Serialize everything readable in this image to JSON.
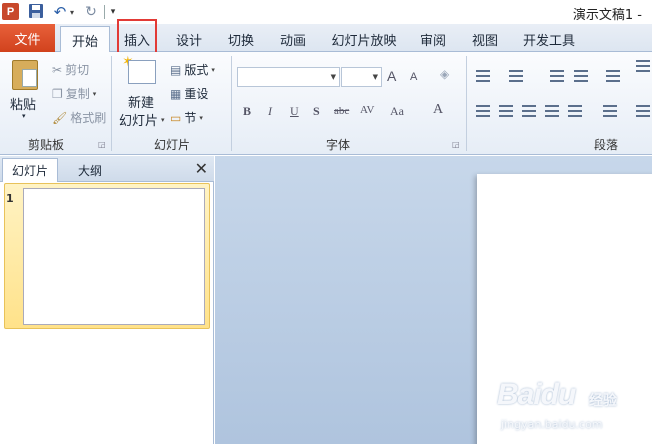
{
  "window": {
    "title": "演示文稿1 -",
    "app_icon": "P"
  },
  "quick_access": {
    "save": "save-icon",
    "undo": "↶",
    "undo_dropdown": "▾",
    "redo": "↻",
    "customize": "▾"
  },
  "tabs": [
    {
      "label": "文件"
    },
    {
      "label": "开始"
    },
    {
      "label": "插入"
    },
    {
      "label": "设计"
    },
    {
      "label": "切换"
    },
    {
      "label": "动画"
    },
    {
      "label": "幻灯片放映"
    },
    {
      "label": "审阅"
    },
    {
      "label": "视图"
    },
    {
      "label": "开发工具"
    }
  ],
  "active_tab": "开始",
  "highlighted_tab": "插入",
  "ribbon": {
    "clipboard": {
      "label": "剪贴板",
      "paste": "粘贴",
      "cut": "剪切",
      "copy": "复制",
      "format_painter": "格式刷"
    },
    "slides": {
      "label": "幻灯片",
      "new_slide_line1": "新建",
      "new_slide_line2": "幻灯片",
      "layout": "版式",
      "reset": "重设",
      "section": "节"
    },
    "font": {
      "label": "字体",
      "font_name": "",
      "font_size": "",
      "grow": "A",
      "shrink": "A",
      "bold": "B",
      "italic": "I",
      "underline": "U",
      "shadow": "S",
      "strike": "abc",
      "spacing": "AV",
      "case": "Aa",
      "color": "A"
    },
    "paragraph": {
      "label": "段落"
    }
  },
  "left_panel": {
    "tab_slides": "幻灯片",
    "tab_outline": "大纲",
    "close": "✕",
    "thumb_number": "1"
  },
  "watermark": {
    "brand": "Baidu",
    "sub": "经验",
    "url": "jingyan.baidu.com"
  },
  "colors": {
    "file_tab": "#d1421d",
    "highlight": "#e23a36",
    "canvas": "#c7d7ea"
  }
}
